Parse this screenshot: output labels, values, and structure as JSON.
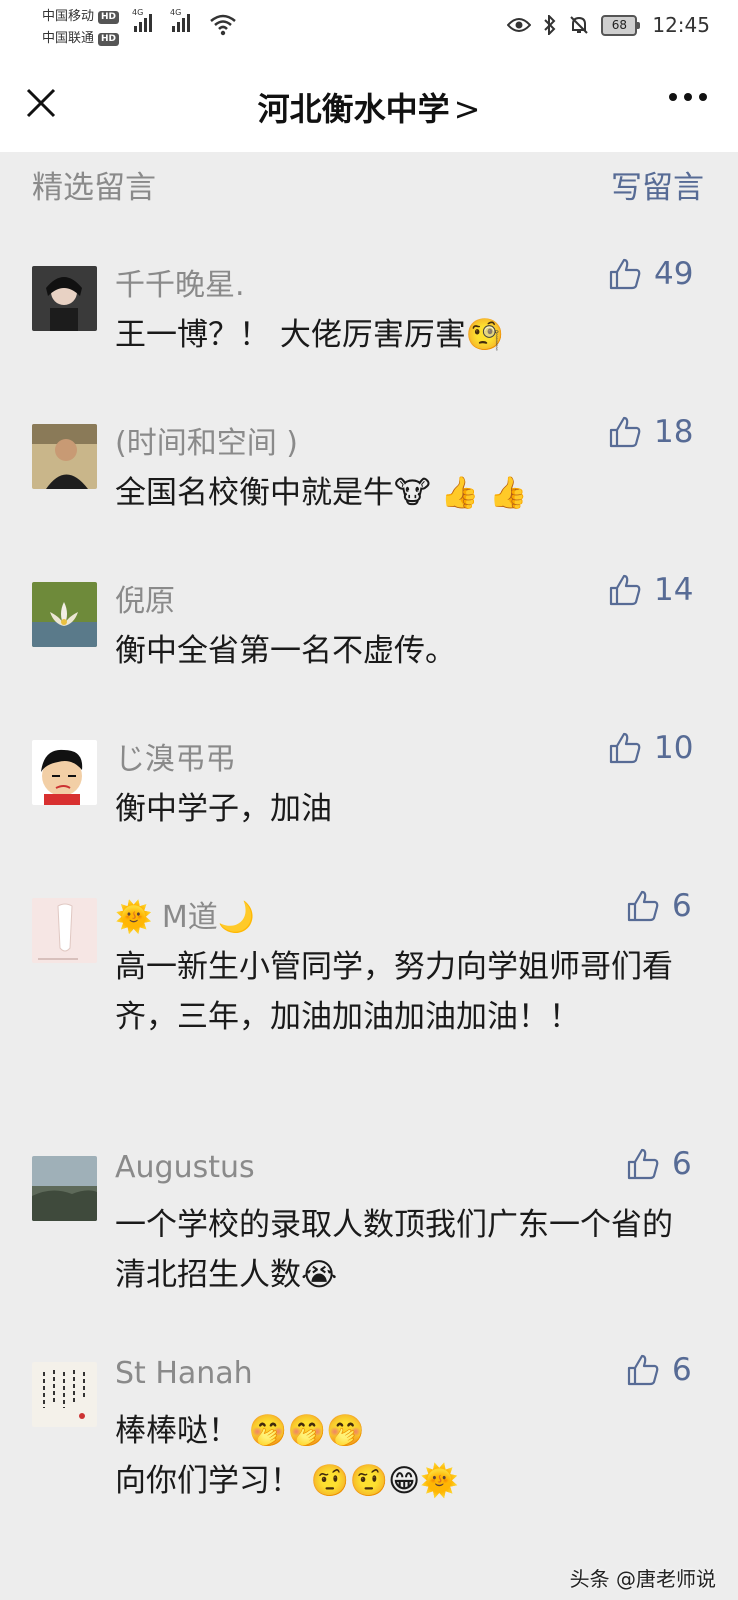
{
  "status_bar": {
    "carrier_1": "中国移动",
    "carrier_2": "中国联通",
    "hd": "HD",
    "net_1": "4G",
    "net_2": "4G",
    "battery": "68",
    "time": "12:45"
  },
  "nav": {
    "title": "河北衡水中学",
    "title_arrow": ">"
  },
  "section": {
    "title": "精选留言",
    "write_comment": "写留言"
  },
  "comments": [
    {
      "name": "千千晚星.",
      "likes": "49",
      "text": "王一博？！ 大佬厉害厉害🧐"
    },
    {
      "name": "(时间和空间 )",
      "likes": "18",
      "text": "全国名校衡中就是牛🐮 👍 👍"
    },
    {
      "name": "倪原",
      "likes": "14",
      "text": "衡中全省第一名不虚传。"
    },
    {
      "name": "じ溴弔弔",
      "likes": "10",
      "text": "衡中学子，加油"
    },
    {
      "name": "🌞 M道🌙",
      "likes": "6",
      "text": "高一新生小管同学，努力向学姐师哥们看齐，三年，加油加油加油加油！！"
    },
    {
      "name": "Augustus",
      "likes": "6",
      "text": "一个学校的录取人数顶我们广东一个省的清北招生人数😭"
    },
    {
      "name": "St Hanah",
      "likes": "6",
      "text": "棒棒哒！ 🤭🤭🤭\n向你们学习！ 🤨🤨😁🌞"
    }
  ],
  "watermark": "头条 @唐老师说",
  "colors": {
    "link_blue": "#576b95",
    "name_gray": "#8a8a8a",
    "background": "#ededed"
  }
}
